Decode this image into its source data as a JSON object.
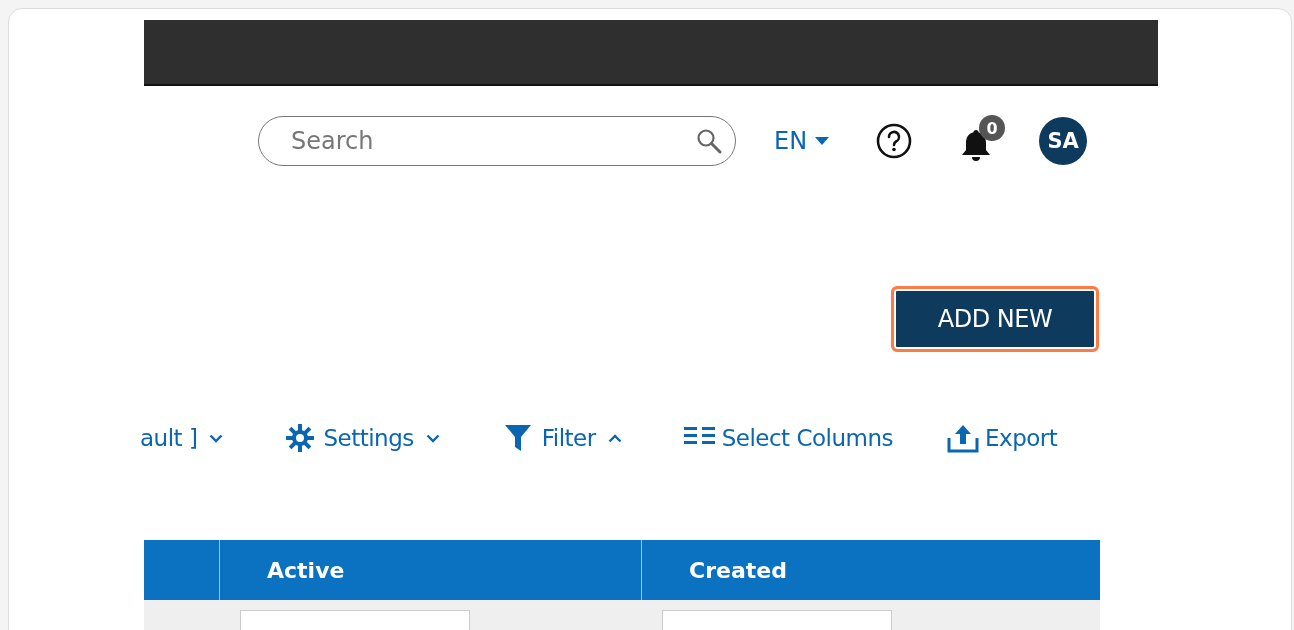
{
  "header": {
    "search": {
      "placeholder": "Search"
    },
    "language": "EN",
    "notifications": "0",
    "avatar": "SA"
  },
  "add_button": {
    "label": "ADD NEW",
    "highlighted": true
  },
  "toolbar": [
    {
      "kind": "view",
      "label": "ault ]",
      "expanded": false
    },
    {
      "kind": "settings",
      "label": "Settings",
      "expanded": false
    },
    {
      "kind": "filter",
      "label": "Filter",
      "expanded": true
    },
    {
      "kind": "columns",
      "label": "Select Columns"
    },
    {
      "kind": "export",
      "label": "Export"
    }
  ],
  "table": {
    "columns": [
      {
        "kind": "blank"
      },
      {
        "kind": "text",
        "label": "Active",
        "filter": true
      },
      {
        "kind": "text",
        "label": "Created",
        "filter": true
      }
    ]
  }
}
